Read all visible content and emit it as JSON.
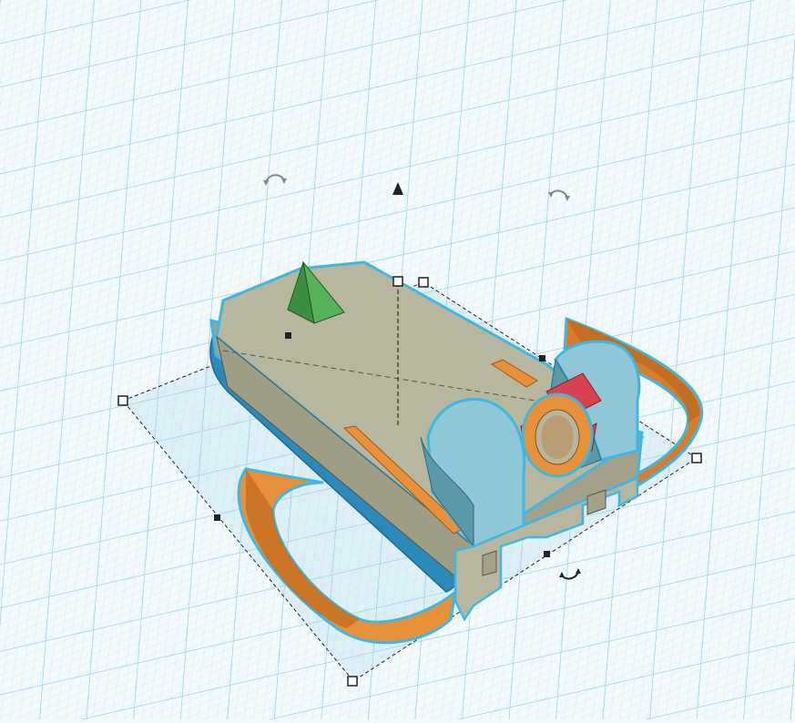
{
  "app": {
    "view": "3D workplane"
  },
  "selection": {
    "outline_color": "#3fb7e3",
    "handle_color": "#222222",
    "rotate_handles": 3,
    "lift_handle": "cone-arrow"
  },
  "colors": {
    "grid_major": "#7cc6e6",
    "grid_minor": "#bfe4f3",
    "body_top": "#b7b79f",
    "body_side": "#a2a28b",
    "bracket": "#8fc7d8",
    "bracket_dark": "#5b98aa",
    "orange": "#e8913b",
    "orange_dark": "#c46e22",
    "blue_cyl": "#2b8ab8",
    "red": "#d8434f",
    "green": "#4aa44a",
    "green_dark": "#2f7a35"
  },
  "icons": [
    "rotate-arrow-icon",
    "lift-cone-icon"
  ]
}
